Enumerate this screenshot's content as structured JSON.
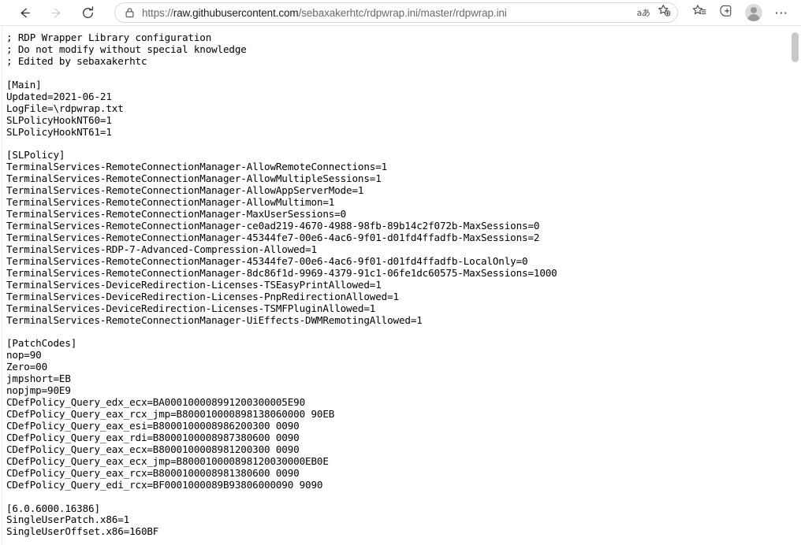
{
  "browser": {
    "nav": {
      "back_label": "Back",
      "forward_label": "Forward",
      "reload_label": "Refresh"
    },
    "address": {
      "lock_label": "Site information",
      "url_full": "https://raw.githubusercontent.com/sebaxakerhtc/rdpwrap.ini/master/rdpwrap.ini",
      "url_scheme": "https://",
      "url_host": "raw.githubusercontent.com",
      "url_path": "/sebaxakerhtc/rdpwrap.ini/master/rdpwrap.ini",
      "read_aloud_glyph": "aあ",
      "read_aloud_label": "Read aloud",
      "add_favorite_label": "Add this page to favorites"
    },
    "toolbar_right": {
      "favorites_label": "Favorites",
      "collections_label": "Collections",
      "profile_label": "Profile",
      "settings_label": "Settings and more",
      "settings_glyph": "⋯"
    },
    "scrollbar": {
      "thumb_label": "Vertical scrollbar"
    }
  },
  "document": {
    "filename": "rdpwrap.ini",
    "lines": [
      "; RDP Wrapper Library configuration",
      "; Do not modify without special knowledge",
      "; Edited by sebaxakerhtc",
      "",
      "[Main]",
      "Updated=2021-06-21",
      "LogFile=\\rdpwrap.txt",
      "SLPolicyHookNT60=1",
      "SLPolicyHookNT61=1",
      "",
      "[SLPolicy]",
      "TerminalServices-RemoteConnectionManager-AllowRemoteConnections=1",
      "TerminalServices-RemoteConnectionManager-AllowMultipleSessions=1",
      "TerminalServices-RemoteConnectionManager-AllowAppServerMode=1",
      "TerminalServices-RemoteConnectionManager-AllowMultimon=1",
      "TerminalServices-RemoteConnectionManager-MaxUserSessions=0",
      "TerminalServices-RemoteConnectionManager-ce0ad219-4670-4988-98fb-89b14c2f072b-MaxSessions=0",
      "TerminalServices-RemoteConnectionManager-45344fe7-00e6-4ac6-9f01-d01fd4ffadfb-MaxSessions=2",
      "TerminalServices-RDP-7-Advanced-Compression-Allowed=1",
      "TerminalServices-RemoteConnectionManager-45344fe7-00e6-4ac6-9f01-d01fd4ffadfb-LocalOnly=0",
      "TerminalServices-RemoteConnectionManager-8dc86f1d-9969-4379-91c1-06fe1dc60575-MaxSessions=1000",
      "TerminalServices-DeviceRedirection-Licenses-TSEasyPrintAllowed=1",
      "TerminalServices-DeviceRedirection-Licenses-PnpRedirectionAllowed=1",
      "TerminalServices-DeviceRedirection-Licenses-TSMFPluginAllowed=1",
      "TerminalServices-RemoteConnectionManager-UiEffects-DWMRemotingAllowed=1",
      "",
      "[PatchCodes]",
      "nop=90",
      "Zero=00",
      "jmpshort=EB",
      "nopjmp=90E9",
      "CDefPolicy_Query_edx_ecx=BA000100008991200300005E90",
      "CDefPolicy_Query_eax_rcx_jmp=B800010000898138060000 90EB",
      "CDefPolicy_Query_eax_esi=B8000100008986200300 0090",
      "CDefPolicy_Query_eax_rdi=B8000100008987380600 0090",
      "CDefPolicy_Query_eax_ecx=B8000100008981200300 0090",
      "CDefPolicy_Query_eax_ecx_jmp=B800010000898120030000EB0E",
      "CDefPolicy_Query_eax_rcx=B8000100008981380600 0090",
      "CDefPolicy_Query_edi_rcx=BF0001000089B93806000090 9090",
      "",
      "[6.0.6000.16386]",
      "SingleUserPatch.x86=1",
      "SingleUserOffset.x86=160BF"
    ]
  }
}
